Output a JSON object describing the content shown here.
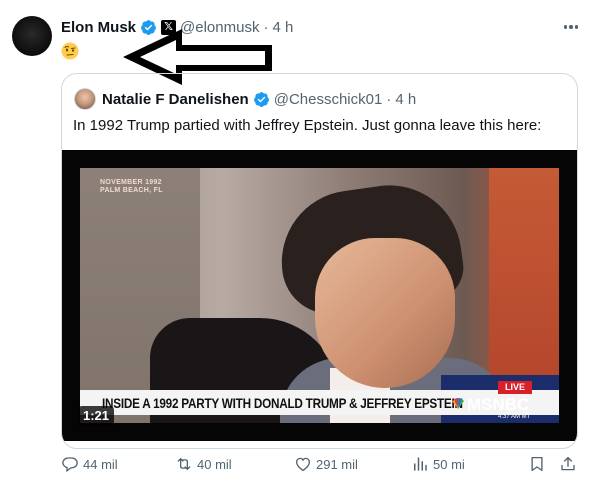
{
  "tweet": {
    "author_name": "Elon Musk",
    "handle": "@elonmusk",
    "separator": "·",
    "time": "4 h",
    "affiliation_badge": "𝕏",
    "body_emoji": "🤨",
    "icons": {
      "verified": "verified-badge-icon",
      "more": "more-options-icon",
      "arrow": "left-arrow-annotation-icon"
    }
  },
  "quoted": {
    "author_name": "Natalie F Danelishen",
    "handle": "@Chesschick01",
    "separator": "·",
    "time": "4 h",
    "text": "In 1992 Trump partied with Jeffrey Epstein. Just gonna leave this here:",
    "video": {
      "duration": "1:21",
      "dateline_1": "NOVEMBER 1992",
      "dateline_2": "PALM BEACH, FL",
      "lower_third": "INSIDE A 1992 PARTY WITH DONALD TRUMP & JEFFREY EPSTEIN",
      "live_badge": "LIVE",
      "network": "MSNBC",
      "clock": "4:37 AM MT"
    }
  },
  "actions": {
    "replies": "44 mil",
    "reposts": "40 mil",
    "likes": "291 mil",
    "views": "50 mi"
  },
  "colors": {
    "verified_blue": "#1d9bf0",
    "secondary_text": "#536471",
    "border": "#cfd9de",
    "live_red": "#d8202b",
    "msnbc_navy": "#1b2d6b"
  }
}
